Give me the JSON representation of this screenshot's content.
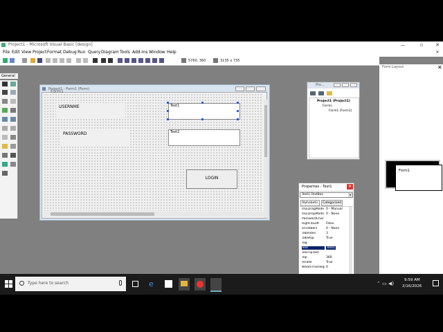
{
  "window": {
    "title": "Project1 - Microsoft Visual Basic [design]"
  },
  "menu": [
    "File",
    "Edit",
    "View",
    "Project",
    "Format",
    "Debug",
    "Run",
    "Query",
    "Diagram",
    "Tools",
    "Add-Ins",
    "Window",
    "Help"
  ],
  "toolbar": {
    "position": "5760, 360",
    "size": "3135 x 735"
  },
  "toolbox": {
    "tab_label": "General"
  },
  "form_designer": {
    "title": "Project1 - Form1 (Form)",
    "form_caption": "Form1",
    "username_label": "USERNME",
    "password_label": "PASSWORD",
    "text1": "Text1",
    "text2": "Text2",
    "login_button": "LOGIN"
  },
  "project_explorer": {
    "title": "Pro...",
    "root": "Project1 (Project1)",
    "folder": "Forms",
    "item": "Form1 (Form1)"
  },
  "properties": {
    "title": "Properties - Text1",
    "object": "Text1 TextBox",
    "tab_alphabetic": "Alphabetic",
    "tab_categorized": "Categorized",
    "rows": [
      {
        "name": "OLEDragMode",
        "value": "0 - Manual"
      },
      {
        "name": "OLEDropMode",
        "value": "0 - None"
      },
      {
        "name": "PasswordChar",
        "value": ""
      },
      {
        "name": "RightToLeft",
        "value": "False"
      },
      {
        "name": "ScrollBars",
        "value": "0 - None"
      },
      {
        "name": "TabIndex",
        "value": "3"
      },
      {
        "name": "TabStop",
        "value": "True"
      },
      {
        "name": "Tag",
        "value": ""
      },
      {
        "name": "Text",
        "value": "Text1"
      },
      {
        "name": "ToolTipText",
        "value": ""
      },
      {
        "name": "Top",
        "value": "360"
      },
      {
        "name": "Visible",
        "value": "True"
      },
      {
        "name": "WhatsThisHelp",
        "value": "0"
      }
    ]
  },
  "form_layout": {
    "title": "Form Layout",
    "form_label": "Form1"
  },
  "taskbar": {
    "search_placeholder": "Type here to search",
    "time": "9:59 AM",
    "date": "2/16/2026"
  },
  "colors": {
    "selection": "#0a246a",
    "handles": "#2a5fd1",
    "taskbar": "#1b1b1b"
  }
}
